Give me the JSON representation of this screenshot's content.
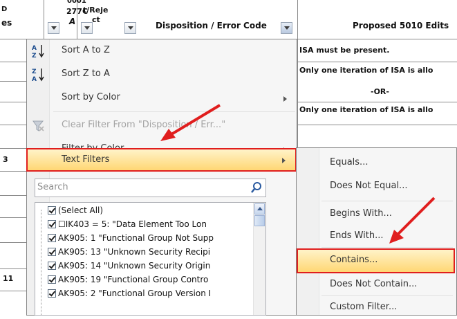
{
  "sheet": {
    "headers": {
      "col_a_top": "D",
      "col_a": "es",
      "col_b_top": "0001",
      "col_b_mid": "277C",
      "col_b": "A",
      "col_c_top": "t/Reje",
      "col_c": "ct",
      "disposition": "Disposition / Error Code",
      "proposed": "Proposed 5010 Edits"
    },
    "left_cells": [
      "3",
      "11"
    ],
    "right_cells": [
      "ISA must be present.",
      "Only one iteration of ISA is allo",
      "-OR-",
      "Only one iteration of ISA is allo"
    ]
  },
  "menu": {
    "items": [
      {
        "id": "sort-a-z",
        "label": "Sort A to Z",
        "underline": "S",
        "icon": "sort-a-to-z-icon",
        "enabled": true,
        "submenu": false
      },
      {
        "id": "sort-z-a",
        "label": "Sort Z to A",
        "underline": "o",
        "icon": "sort-z-to-a-icon",
        "enabled": true,
        "submenu": false
      },
      {
        "id": "sort-color",
        "label": "Sort by Color",
        "underline": "t",
        "icon": "",
        "enabled": true,
        "submenu": true
      },
      {
        "id": "clear-filter",
        "label": "Clear Filter From \"Disposition / Err...\"",
        "underline": "C",
        "icon": "clear-filter-icon",
        "enabled": false,
        "submenu": false
      },
      {
        "id": "filter-color",
        "label": "Filter by Color",
        "underline": "i",
        "icon": "",
        "enabled": true,
        "submenu": true
      },
      {
        "id": "text-filters",
        "label": "Text Filters",
        "underline": "F",
        "icon": "",
        "enabled": true,
        "submenu": true
      }
    ],
    "search_placeholder": "Search",
    "list": [
      "(Select All)",
      "☐IK403 = 5: \"Data Element Too Lon",
      "AK905: 1 \"Functional Group Not Supp",
      "AK905: 13 \"Unknown Security Recipi",
      "AK905: 14 \"Unknown Security Origin",
      "AK905: 19 \"Functional Group Contro",
      "AK905: 2 \"Functional Group Version I"
    ]
  },
  "submenu": {
    "items": [
      {
        "id": "equals",
        "label": "Equals..."
      },
      {
        "id": "not-equal",
        "label": "Does Not Equal..."
      },
      {
        "id": "begins-with",
        "label": "Begins With..."
      },
      {
        "id": "ends-with",
        "label": "Ends With..."
      },
      {
        "id": "contains",
        "label": "Contains..."
      },
      {
        "id": "not-contain",
        "label": "Does Not Contain..."
      },
      {
        "id": "custom",
        "label": "Custom Filter..."
      }
    ]
  },
  "colors": {
    "highlight_border": "#e01e1e",
    "highlight_fill_top": "#fff3c9",
    "highlight_fill_bottom": "#ffd774",
    "annotation_arrow": "#e01e1e"
  }
}
